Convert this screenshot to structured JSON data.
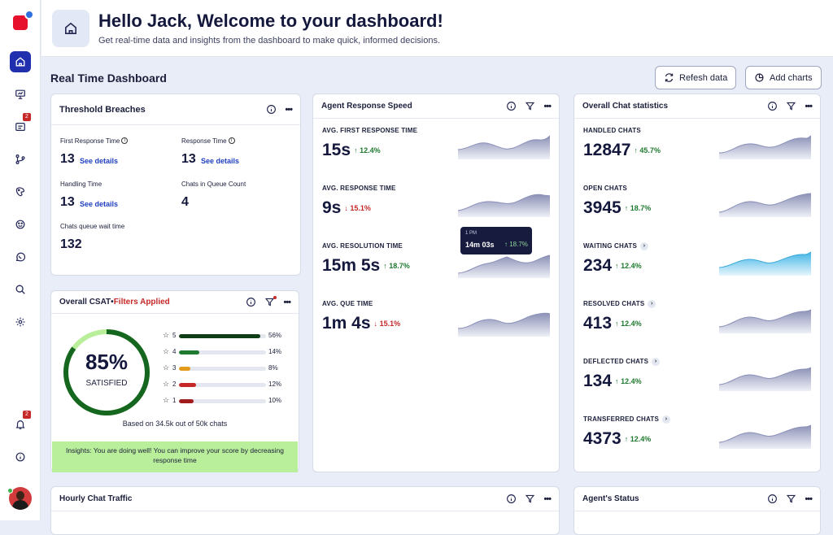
{
  "header": {
    "title": "Hello Jack, Welcome to your dashboard!",
    "subtitle": "Get real-time data and insights from the dashboard to make quick, informed decisions."
  },
  "sidebar": {
    "notification_badge": "2",
    "bell_badge": "2"
  },
  "dashboard": {
    "title": "Real Time Dashboard",
    "refresh_label": "Refesh data",
    "add_charts_label": "Add charts"
  },
  "threshold": {
    "title": "Threshold Breaches",
    "info_symbol": "i",
    "first_response_label": "First Response Time",
    "first_response_value": "13",
    "response_label": "Response Time",
    "response_value": "13",
    "handling_label": "Handling Time",
    "handling_value": "13",
    "queue_count_label": "Chats in Queue Count",
    "queue_count_value": "4",
    "wait_label": "Chats queue wait time",
    "wait_value": "132",
    "see_details": "See details"
  },
  "csat": {
    "title": "Overall CSAT",
    "separator": " • ",
    "filters": "Filters Applied",
    "percent": "85%",
    "percent_value": 85,
    "satisfied": "SATISFIED",
    "ratings": [
      {
        "star": "5",
        "pct": "56%",
        "value": 56,
        "color": "#0f3d16"
      },
      {
        "star": "4",
        "pct": "14%",
        "value": 14,
        "color": "#1e7a2e"
      },
      {
        "star": "3",
        "pct": "8%",
        "value": 8,
        "color": "#e39b1e"
      },
      {
        "star": "2",
        "pct": "12%",
        "value": 12,
        "color": "#c62828"
      },
      {
        "star": "1",
        "pct": "10%",
        "value": 10,
        "color": "#a11d1d"
      }
    ],
    "based_on": "Based on 34.5k out of 50k chats",
    "insights": "Insights:  You are doing well! You can improve your score by decreasing response time"
  },
  "agent_speed": {
    "title": "Agent Response Speed",
    "metrics": [
      {
        "label": "AVG. FIRST RESPONSE TIME",
        "value": "15s",
        "delta": "12.4%",
        "dir": "up"
      },
      {
        "label": "AVG. RESPONSE TIME",
        "value": "9s",
        "delta": "15.1%",
        "dir": "down"
      },
      {
        "label": "AVG. RESOLUTION TIME",
        "value": "15m 5s",
        "delta": "18.7%",
        "dir": "up"
      },
      {
        "label": "AVG. QUE TIME",
        "value": "1m 4s",
        "delta": "15.1%",
        "dir": "down"
      }
    ],
    "tooltip": {
      "time": "1 PM",
      "value": "14m 03s",
      "delta": "18.7%"
    }
  },
  "chat_stats": {
    "title": "Overall Chat statistics",
    "metrics": [
      {
        "label": "HANDLED CHATS",
        "value": "12847",
        "delta": "45.7%",
        "chevron": false
      },
      {
        "label": "OPEN CHATS",
        "value": "3945",
        "delta": "18.7%",
        "chevron": false
      },
      {
        "label": "WAITING CHATS",
        "value": "234",
        "delta": "12.4%",
        "chevron": true
      },
      {
        "label": "RESOLVED CHATS",
        "value": "413",
        "delta": "12.4%",
        "chevron": true
      },
      {
        "label": "DEFLECTED CHATS",
        "value": "134",
        "delta": "12.4%",
        "chevron": true
      },
      {
        "label": "TRANSFERRED CHATS",
        "value": "4373",
        "delta": "12.4%",
        "chevron": true
      }
    ]
  },
  "hourly": {
    "title": "Hourly Chat Traffic"
  },
  "agents": {
    "title": "Agent's Status"
  },
  "symbols": {
    "up": "↑",
    "down": "↓",
    "dots": "•••",
    "star": "☆",
    "chevron": "›"
  },
  "colors": {
    "primary": "#1f2fae",
    "brand": "#e8112d",
    "up": "#1e7a2e",
    "down": "#c62828",
    "insights_bg": "#b9ee9a"
  }
}
